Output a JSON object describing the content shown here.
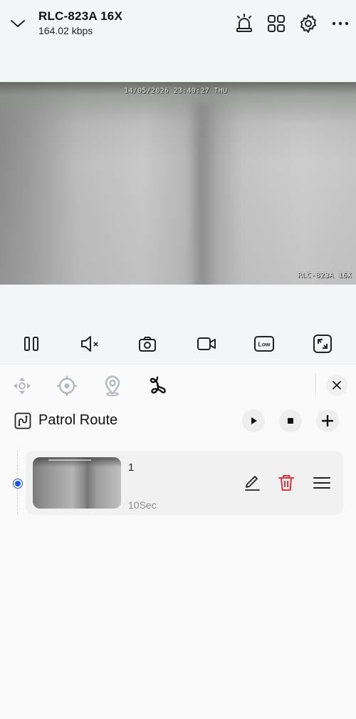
{
  "header": {
    "camera_name": "RLC-823A 16X",
    "bitrate": "164.02 kbps",
    "icons": [
      "chevron-down-icon",
      "siren-icon",
      "grid-view-icon",
      "gear-icon",
      "more-icon"
    ]
  },
  "video": {
    "timestamp": "14/05/2026 23:40:27 THU",
    "overlay_name": "RLC-823A 16X"
  },
  "controls": {
    "icons": [
      "pause-icon",
      "mute-icon",
      "snapshot-icon",
      "record-icon",
      "quality-icon",
      "fullscreen-icon"
    ],
    "quality_label": "Low"
  },
  "ptz_tabs": {
    "icons": [
      "ptz-direction-icon",
      "preset-target-icon",
      "location-pin-icon",
      "patrol-icon"
    ],
    "active": "patrol-icon"
  },
  "patrol": {
    "title": "Patrol Route",
    "actions": [
      "play-icon",
      "stop-icon",
      "add-icon"
    ],
    "presets": [
      {
        "name": "1",
        "duration": "10Sec"
      }
    ]
  },
  "colors": {
    "accent_blue": "#1a56e8",
    "delete_red": "#e8333b"
  }
}
